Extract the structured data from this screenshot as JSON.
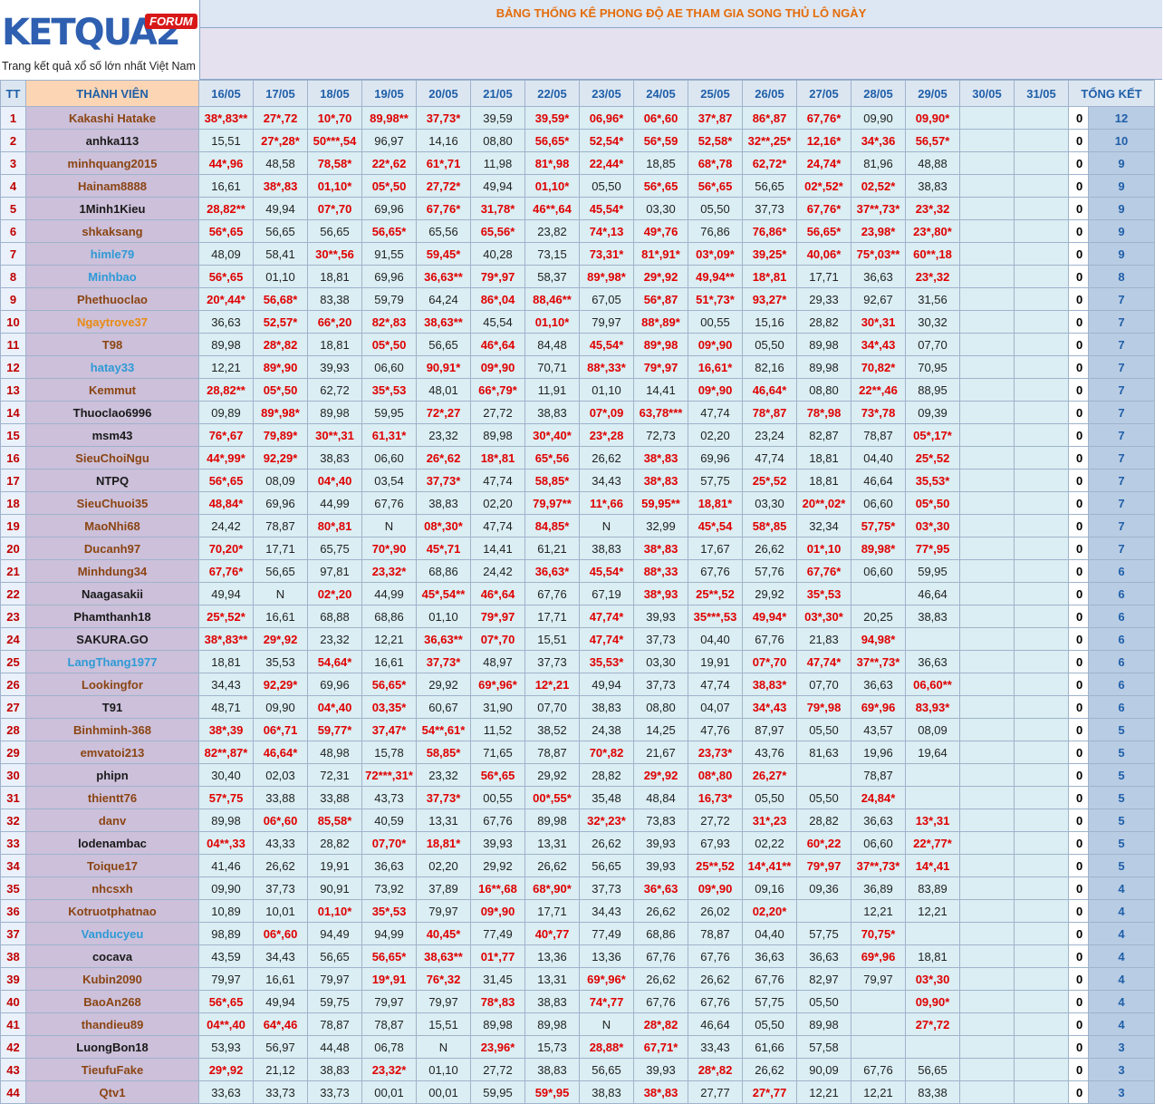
{
  "logo": {
    "brand": "KETQUA2",
    "badge": "FORUM",
    "tagline": "Trang kết quả xổ số lớn nhất Việt Nam"
  },
  "title": "BẢNG THỐNG KÊ PHONG ĐỘ AE THAM GIA SONG THỦ LÔ NGÀY",
  "headers": {
    "tt": "TT",
    "member": "THÀNH VIÊN",
    "dates": [
      "16/05",
      "17/05",
      "18/05",
      "19/05",
      "20/05",
      "21/05",
      "22/05",
      "23/05",
      "24/05",
      "25/05",
      "26/05",
      "27/05",
      "28/05",
      "29/05",
      "30/05",
      "31/05"
    ],
    "total": "TỔNG KẾT"
  },
  "name_colors": {
    "brown": "#8b4513",
    "black": "#1a1a1a",
    "blue": "#2e9ad6",
    "orange": "#e98a12"
  },
  "hit_color": "#e00000",
  "rows": [
    {
      "tt": "1",
      "name": "Kakashi Hatake",
      "nc": "brown",
      "cells": [
        "38*,83**",
        "27*,72",
        "10*,70",
        "89,98**",
        "37,73*",
        "39,59",
        "39,59*",
        "06,96*",
        "06*,60",
        "37*,87",
        "86*,87",
        "67,76*",
        "09,90",
        "09,90*",
        "",
        ""
      ],
      "zero": "0",
      "total": "12"
    },
    {
      "tt": "2",
      "name": "anhka113",
      "nc": "black",
      "cells": [
        "15,51",
        "27*,28*",
        "50***,54",
        "96,97",
        "14,16",
        "08,80",
        "56,65*",
        "52,54*",
        "56*,59",
        "52,58*",
        "32**,25*",
        "12,16*",
        "34*,36",
        "56,57*",
        "",
        ""
      ],
      "zero": "0",
      "total": "10"
    },
    {
      "tt": "3",
      "name": "minhquang2015",
      "nc": "brown",
      "cells": [
        "44*,96",
        "48,58",
        "78,58*",
        "22*,62",
        "61*,71",
        "11,98",
        "81*,98",
        "22,44*",
        "18,85",
        "68*,78",
        "62,72*",
        "24,74*",
        "81,96",
        "48,88",
        "",
        ""
      ],
      "zero": "0",
      "total": "9"
    },
    {
      "tt": "4",
      "name": "Hainam8888",
      "nc": "brown",
      "cells": [
        "16,61",
        "38*,83",
        "01,10*",
        "05*,50",
        "27,72*",
        "49,94",
        "01,10*",
        "05,50",
        "56*,65",
        "56*,65",
        "56,65",
        "02*,52*",
        "02,52*",
        "38,83",
        "",
        ""
      ],
      "zero": "0",
      "total": "9"
    },
    {
      "tt": "5",
      "name": "1Minh1Kieu",
      "nc": "black",
      "cells": [
        "28,82**",
        "49,94",
        "07*,70",
        "69,96",
        "67,76*",
        "31,78*",
        "46**,64",
        "45,54*",
        "03,30",
        "05,50",
        "37,73",
        "67,76*",
        "37**,73*",
        "23*,32",
        "",
        ""
      ],
      "zero": "0",
      "total": "9"
    },
    {
      "tt": "6",
      "name": "shkaksang",
      "nc": "brown",
      "cells": [
        "56*,65",
        "56,65",
        "56,65",
        "56,65*",
        "65,56",
        "65,56*",
        "23,82",
        "74*,13",
        "49*,76",
        "76,86",
        "76,86*",
        "56,65*",
        "23,98*",
        "23*,80*",
        "",
        ""
      ],
      "zero": "0",
      "total": "9"
    },
    {
      "tt": "7",
      "name": "himle79",
      "nc": "blue",
      "cells": [
        "48,09",
        "58,41",
        "30**,56",
        "91,55",
        "59,45*",
        "40,28",
        "73,15",
        "73,31*",
        "81*,91*",
        "03*,09*",
        "39,25*",
        "40,06*",
        "75*,03**",
        "60**,18",
        "",
        ""
      ],
      "zero": "0",
      "total": "9"
    },
    {
      "tt": "8",
      "name": "Minhbao",
      "nc": "blue",
      "cells": [
        "56*,65",
        "01,10",
        "18,81",
        "69,96",
        "36,63**",
        "79*,97",
        "58,37",
        "89*,98*",
        "29*,92",
        "49,94**",
        "18*,81",
        "17,71",
        "36,63",
        "23*,32",
        "",
        ""
      ],
      "zero": "0",
      "total": "8"
    },
    {
      "tt": "9",
      "name": "Phethuoclao",
      "nc": "brown",
      "cells": [
        "20*,44*",
        "56,68*",
        "83,38",
        "59,79",
        "64,24",
        "86*,04",
        "88,46**",
        "67,05",
        "56*,87",
        "51*,73*",
        "93,27*",
        "29,33",
        "92,67",
        "31,56",
        "",
        ""
      ],
      "zero": "0",
      "total": "7"
    },
    {
      "tt": "10",
      "name": "Ngaytrove37",
      "nc": "orange",
      "cells": [
        "36,63",
        "52,57*",
        "66*,20",
        "82*,83",
        "38,63**",
        "45,54",
        "01,10*",
        "79,97",
        "88*,89*",
        "00,55",
        "15,16",
        "28,82",
        "30*,31",
        "30,32",
        "",
        ""
      ],
      "zero": "0",
      "total": "7"
    },
    {
      "tt": "11",
      "name": "T98",
      "nc": "brown",
      "cells": [
        "89,98",
        "28*,82",
        "18,81",
        "05*,50",
        "56,65",
        "46*,64",
        "84,48",
        "45,54*",
        "89*,98",
        "09*,90",
        "05,50",
        "89,98",
        "34*,43",
        "07,70",
        "",
        ""
      ],
      "zero": "0",
      "total": "7"
    },
    {
      "tt": "12",
      "name": "hatay33",
      "nc": "blue",
      "cells": [
        "12,21",
        "89*,90",
        "39,93",
        "06,60",
        "90,91*",
        "09*,90",
        "70,71",
        "88*,33*",
        "79*,97",
        "16,61*",
        "82,16",
        "89,98",
        "70,82*",
        "70,95",
        "",
        ""
      ],
      "zero": "0",
      "total": "7"
    },
    {
      "tt": "13",
      "name": "Kemmut",
      "nc": "brown",
      "cells": [
        "28,82**",
        "05*,50",
        "62,72",
        "35*,53",
        "48,01",
        "66*,79*",
        "11,91",
        "01,10",
        "14,41",
        "09*,90",
        "46,64*",
        "08,80",
        "22**,46",
        "88,95",
        "",
        ""
      ],
      "zero": "0",
      "total": "7"
    },
    {
      "tt": "14",
      "name": "Thuoclao6996",
      "nc": "black",
      "cells": [
        "09,89",
        "89*,98*",
        "89,98",
        "59,95",
        "72*,27",
        "27,72",
        "38,83",
        "07*,09",
        "63,78***",
        "47,74",
        "78*,87",
        "78*,98",
        "73*,78",
        "09,39",
        "",
        ""
      ],
      "zero": "0",
      "total": "7"
    },
    {
      "tt": "15",
      "name": "msm43",
      "nc": "black",
      "cells": [
        "76*,67",
        "79,89*",
        "30**,31",
        "61,31*",
        "23,32",
        "89,98",
        "30*,40*",
        "23*,28",
        "72,73",
        "02,20",
        "23,24",
        "82,87",
        "78,87",
        "05*,17*",
        "",
        ""
      ],
      "zero": "0",
      "total": "7"
    },
    {
      "tt": "16",
      "name": "SieuChoiNgu",
      "nc": "brown",
      "cells": [
        "44*,99*",
        "92,29*",
        "38,83",
        "06,60",
        "26*,62",
        "18*,81",
        "65*,56",
        "26,62",
        "38*,83",
        "69,96",
        "47,74",
        "18,81",
        "04,40",
        "25*,52",
        "",
        ""
      ],
      "zero": "0",
      "total": "7"
    },
    {
      "tt": "17",
      "name": "NTPQ",
      "nc": "black",
      "cells": [
        "56*,65",
        "08,09",
        "04*,40",
        "03,54",
        "37,73*",
        "47,74",
        "58,85*",
        "34,43",
        "38*,83",
        "57,75",
        "25*,52",
        "18,81",
        "46,64",
        "35,53*",
        "",
        ""
      ],
      "zero": "0",
      "total": "7"
    },
    {
      "tt": "18",
      "name": "SieuChuoi35",
      "nc": "brown",
      "cells": [
        "48,84*",
        "69,96",
        "44,99",
        "67,76",
        "38,83",
        "02,20",
        "79,97**",
        "11*,66",
        "59,95**",
        "18,81*",
        "03,30",
        "20**,02*",
        "06,60",
        "05*,50",
        "",
        ""
      ],
      "zero": "0",
      "total": "7"
    },
    {
      "tt": "19",
      "name": "MaoNhi68",
      "nc": "brown",
      "cells": [
        "24,42",
        "78,87",
        "80*,81",
        "N",
        "08*,30*",
        "47,74",
        "84,85*",
        "N",
        "32,99",
        "45*,54",
        "58*,85",
        "32,34",
        "57,75*",
        "03*,30",
        "",
        ""
      ],
      "zero": "0",
      "total": "7"
    },
    {
      "tt": "20",
      "name": "Ducanh97",
      "nc": "brown",
      "cells": [
        "70,20*",
        "17,71",
        "65,75",
        "70*,90",
        "45*,71",
        "14,41",
        "61,21",
        "38,83",
        "38*,83",
        "17,67",
        "26,62",
        "01*,10",
        "89,98*",
        "77*,95",
        "",
        ""
      ],
      "zero": "0",
      "total": "7"
    },
    {
      "tt": "21",
      "name": "Minhdung34",
      "nc": "brown",
      "cells": [
        "67,76*",
        "56,65",
        "97,81",
        "23,32*",
        "68,86",
        "24,42",
        "36,63*",
        "45,54*",
        "88*,33",
        "67,76",
        "57,76",
        "67,76*",
        "06,60",
        "59,95",
        "",
        ""
      ],
      "zero": "0",
      "total": "6"
    },
    {
      "tt": "22",
      "name": "Naagasakii",
      "nc": "black",
      "cells": [
        "49,94",
        "N",
        "02*,20",
        "44,99",
        "45*,54**",
        "46*,64",
        "67,76",
        "67,19",
        "38*,93",
        "25**,52",
        "29,92",
        "35*,53",
        "",
        "46,64",
        "",
        ""
      ],
      "zero": "0",
      "total": "6"
    },
    {
      "tt": "23",
      "name": "Phamthanh18",
      "nc": "black",
      "cells": [
        "25*,52*",
        "16,61",
        "68,88",
        "68,86",
        "01,10",
        "79*,97",
        "17,71",
        "47,74*",
        "39,93",
        "35***,53",
        "49,94*",
        "03*,30*",
        "20,25",
        "38,83",
        "",
        ""
      ],
      "zero": "0",
      "total": "6"
    },
    {
      "tt": "24",
      "name": "SAKURA.GO",
      "nc": "black",
      "cells": [
        "38*,83**",
        "29*,92",
        "23,32",
        "12,21",
        "36,63**",
        "07*,70",
        "15,51",
        "47,74*",
        "37,73",
        "04,40",
        "67,76",
        "21,83",
        "94,98*",
        "",
        "",
        ""
      ],
      "zero": "0",
      "total": "6"
    },
    {
      "tt": "25",
      "name": "LangThang1977",
      "nc": "blue",
      "cells": [
        "18,81",
        "35,53",
        "54,64*",
        "16,61",
        "37,73*",
        "48,97",
        "37,73",
        "35,53*",
        "03,30",
        "19,91",
        "07*,70",
        "47,74*",
        "37**,73*",
        "36,63",
        "",
        ""
      ],
      "zero": "0",
      "total": "6"
    },
    {
      "tt": "26",
      "name": "Lookingfor",
      "nc": "brown",
      "cells": [
        "34,43",
        "92,29*",
        "69,96",
        "56,65*",
        "29,92",
        "69*,96*",
        "12*,21",
        "49,94",
        "37,73",
        "47,74",
        "38,83*",
        "07,70",
        "36,63",
        "06,60**",
        "",
        ""
      ],
      "zero": "0",
      "total": "6"
    },
    {
      "tt": "27",
      "name": "T91",
      "nc": "black",
      "cells": [
        "48,71",
        "09,90",
        "04*,40",
        "03,35*",
        "60,67",
        "31,90",
        "07,70",
        "38,83",
        "08,80",
        "04,07",
        "34*,43",
        "79*,98",
        "69*,96",
        "83,93*",
        "",
        ""
      ],
      "zero": "0",
      "total": "6"
    },
    {
      "tt": "28",
      "name": "Binhminh-368",
      "nc": "brown",
      "cells": [
        "38*,39",
        "06*,71",
        "59,77*",
        "37,47*",
        "54**,61*",
        "11,52",
        "38,52",
        "24,38",
        "14,25",
        "47,76",
        "87,97",
        "05,50",
        "43,57",
        "08,09",
        "",
        ""
      ],
      "zero": "0",
      "total": "5"
    },
    {
      "tt": "29",
      "name": "emvatoi213",
      "nc": "brown",
      "cells": [
        "82**,87*",
        "46,64*",
        "48,98",
        "15,78",
        "58,85*",
        "71,65",
        "78,87",
        "70*,82",
        "21,67",
        "23,73*",
        "43,76",
        "81,63",
        "19,96",
        "19,64",
        "",
        ""
      ],
      "zero": "0",
      "total": "5"
    },
    {
      "tt": "30",
      "name": "phipn",
      "nc": "black",
      "cells": [
        "30,40",
        "02,03",
        "72,31",
        "72***,31*",
        "23,32",
        "56*,65",
        "29,92",
        "28,82",
        "29*,92",
        "08*,80",
        "26,27*",
        "",
        "78,87",
        "",
        "",
        ""
      ],
      "zero": "0",
      "total": "5"
    },
    {
      "tt": "31",
      "name": "thientt76",
      "nc": "brown",
      "cells": [
        "57*,75",
        "33,88",
        "33,88",
        "43,73",
        "37,73*",
        "00,55",
        "00*,55*",
        "35,48",
        "48,84",
        "16,73*",
        "05,50",
        "05,50",
        "24,84*",
        "",
        "",
        ""
      ],
      "zero": "0",
      "total": "5"
    },
    {
      "tt": "32",
      "name": "danv",
      "nc": "brown",
      "cells": [
        "89,98",
        "06*,60",
        "85,58*",
        "40,59",
        "13,31",
        "67,76",
        "89,98",
        "32*,23*",
        "73,83",
        "27,72",
        "31*,23",
        "28,82",
        "36,63",
        "13*,31",
        "",
        ""
      ],
      "zero": "0",
      "total": "5"
    },
    {
      "tt": "33",
      "name": "lodenambac",
      "nc": "black",
      "cells": [
        "04**,33",
        "43,33",
        "28,82",
        "07,70*",
        "18,81*",
        "39,93",
        "13,31",
        "26,62",
        "39,93",
        "67,93",
        "02,22",
        "60*,22",
        "06,60",
        "22*,77*",
        "",
        ""
      ],
      "zero": "0",
      "total": "5"
    },
    {
      "tt": "34",
      "name": "Toique17",
      "nc": "brown",
      "cells": [
        "41,46",
        "26,62",
        "19,91",
        "36,63",
        "02,20",
        "29,92",
        "26,62",
        "56,65",
        "39,93",
        "25**,52",
        "14*,41**",
        "79*,97",
        "37**,73*",
        "14*,41",
        "",
        ""
      ],
      "zero": "0",
      "total": "5"
    },
    {
      "tt": "35",
      "name": "nhcsxh",
      "nc": "brown",
      "cells": [
        "09,90",
        "37,73",
        "90,91",
        "73,92",
        "37,89",
        "16**,68",
        "68*,90*",
        "37,73",
        "36*,63",
        "09*,90",
        "09,16",
        "09,36",
        "36,89",
        "83,89",
        "",
        ""
      ],
      "zero": "0",
      "total": "4"
    },
    {
      "tt": "36",
      "name": "Kotruotphatnao",
      "nc": "brown",
      "cells": [
        "10,89",
        "10,01",
        "01,10*",
        "35*,53",
        "79,97",
        "09*,90",
        "17,71",
        "34,43",
        "26,62",
        "26,02",
        "02,20*",
        "",
        "12,21",
        "12,21",
        "",
        ""
      ],
      "zero": "0",
      "total": "4"
    },
    {
      "tt": "37",
      "name": "Vanducyeu",
      "nc": "blue",
      "cells": [
        "98,89",
        "06*,60",
        "94,49",
        "94,99",
        "40,45*",
        "77,49",
        "40*,77",
        "77,49",
        "68,86",
        "78,87",
        "04,40",
        "57,75",
        "70,75*",
        "",
        "",
        ""
      ],
      "zero": "0",
      "total": "4"
    },
    {
      "tt": "38",
      "name": "cocava",
      "nc": "black",
      "cells": [
        "43,59",
        "34,43",
        "56,65",
        "56,65*",
        "38,63**",
        "01*,77",
        "13,36",
        "13,36",
        "67,76",
        "67,76",
        "36,63",
        "36,63",
        "69*,96",
        "18,81",
        "",
        ""
      ],
      "zero": "0",
      "total": "4"
    },
    {
      "tt": "39",
      "name": "Kubin2090",
      "nc": "brown",
      "cells": [
        "79,97",
        "16,61",
        "79,97",
        "19*,91",
        "76*,32",
        "31,45",
        "13,31",
        "69*,96*",
        "26,62",
        "26,62",
        "67,76",
        "82,97",
        "79,97",
        "03*,30",
        "",
        ""
      ],
      "zero": "0",
      "total": "4"
    },
    {
      "tt": "40",
      "name": "BaoAn268",
      "nc": "brown",
      "cells": [
        "56*,65",
        "49,94",
        "59,75",
        "79,97",
        "79,97",
        "78*,83",
        "38,83",
        "74*,77",
        "67,76",
        "67,76",
        "57,75",
        "05,50",
        "",
        "09,90*",
        "",
        ""
      ],
      "zero": "0",
      "total": "4"
    },
    {
      "tt": "41",
      "name": "thandieu89",
      "nc": "brown",
      "cells": [
        "04**,40",
        "64*,46",
        "78,87",
        "78,87",
        "15,51",
        "89,98",
        "89,98",
        "N",
        "28*,82",
        "46,64",
        "05,50",
        "89,98",
        "",
        "27*,72",
        "",
        ""
      ],
      "zero": "0",
      "total": "4"
    },
    {
      "tt": "42",
      "name": "LuongBon18",
      "nc": "black",
      "cells": [
        "53,93",
        "56,97",
        "44,48",
        "06,78",
        "N",
        "23,96*",
        "15,73",
        "28,88*",
        "67,71*",
        "33,43",
        "61,66",
        "57,58",
        "",
        "",
        "",
        ""
      ],
      "zero": "0",
      "total": "3"
    },
    {
      "tt": "43",
      "name": "TieufuFake",
      "nc": "brown",
      "cells": [
        "29*,92",
        "21,12",
        "38,83",
        "23,32*",
        "01,10",
        "27,72",
        "38,83",
        "56,65",
        "39,93",
        "28*,82",
        "26,62",
        "90,09",
        "67,76",
        "56,65",
        "",
        ""
      ],
      "zero": "0",
      "total": "3"
    },
    {
      "tt": "44",
      "name": "Qtv1",
      "nc": "brown",
      "cells": [
        "33,63",
        "33,73",
        "33,73",
        "00,01",
        "00,01",
        "59,95",
        "59*,95",
        "38,83",
        "38*,83",
        "27,77",
        "27*,77",
        "12,21",
        "12,21",
        "83,38",
        "",
        ""
      ],
      "zero": "0",
      "total": "3"
    }
  ]
}
